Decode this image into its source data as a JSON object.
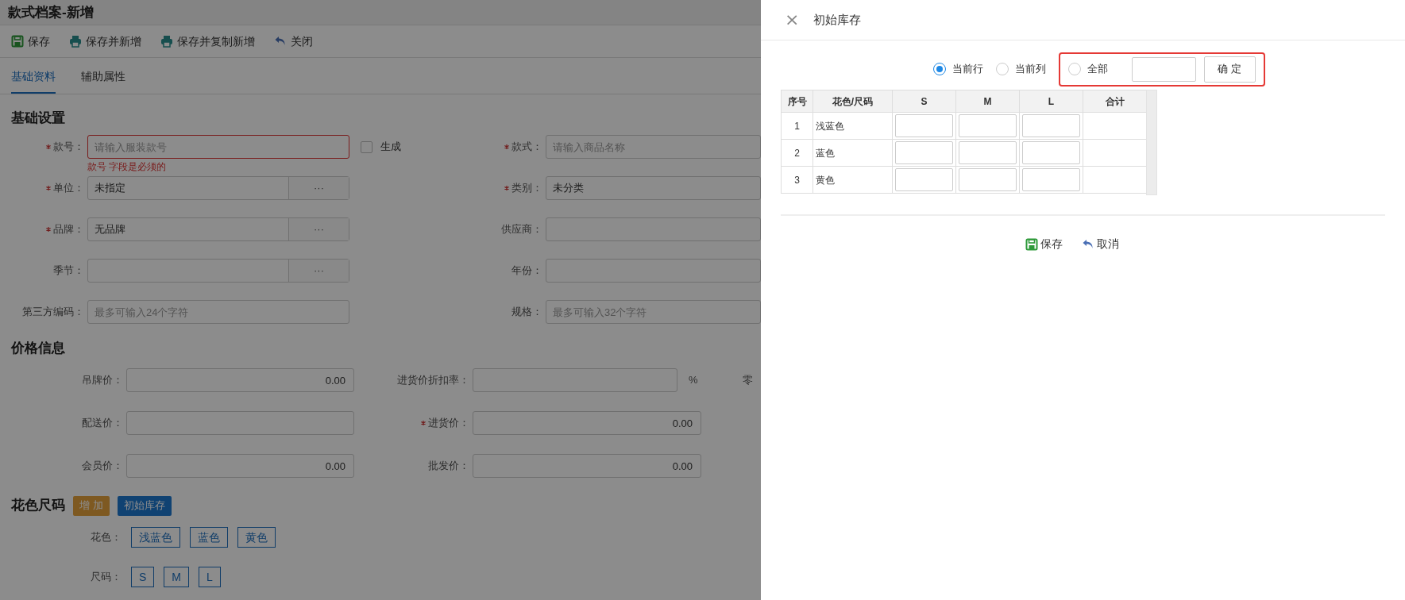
{
  "page": {
    "title": "款式档案-新增",
    "toolbar": [
      {
        "kind": "save",
        "label": "保存"
      },
      {
        "kind": "print",
        "label": "保存并新增"
      },
      {
        "kind": "print",
        "label": "保存并复制新增"
      },
      {
        "kind": "back",
        "label": "关闭"
      }
    ],
    "tabs": [
      {
        "label": "基础资料",
        "selected": true
      },
      {
        "label": "辅助属性",
        "selected": false
      }
    ],
    "basic_section": {
      "title": "基础设置",
      "fields": [
        {
          "label": "款号：",
          "required": true,
          "placeholder": "请输入服装款号",
          "error": "款号 字段是必须的",
          "checkbox": {
            "label": "生成",
            "checked": false
          }
        },
        {
          "label": "款式：",
          "required": true,
          "placeholder": "请输入商品名称"
        },
        {
          "label": "单位：",
          "required": true,
          "value": "未指定",
          "picker": "···"
        },
        {
          "label": "类别：",
          "required": true,
          "value": "未分类"
        },
        {
          "label": "品牌：",
          "required": true,
          "value": "无品牌",
          "picker": "···"
        },
        {
          "label": "供应商：",
          "required": false
        },
        {
          "label": "季节：",
          "required": false,
          "picker": "···"
        },
        {
          "label": "年份：",
          "required": false
        },
        {
          "label": "第三方编码：",
          "required": false,
          "placeholder": "最多可输入24个字符"
        },
        {
          "label": "规格：",
          "required": false,
          "placeholder": "最多可输入32个字符"
        }
      ]
    },
    "price_section": {
      "title": "价格信息",
      "rows": [
        [
          {
            "label": "吊牌价：",
            "required": false,
            "value": "0.00"
          },
          {
            "label": "进货价折扣率：",
            "required": false,
            "unit": "%"
          },
          {
            "label": "零",
            "required": false
          }
        ],
        [
          {
            "label": "配送价：",
            "required": false
          },
          {
            "label": "进货价：",
            "required": true,
            "value": "0.00"
          }
        ],
        [
          {
            "label": "会员价：",
            "required": false,
            "value": "0.00"
          },
          {
            "label": "批发价：",
            "required": false,
            "value": "0.00"
          }
        ]
      ]
    },
    "color_size_section": {
      "title": "花色尺码",
      "buttons": [
        {
          "kind": "warning",
          "label": "增 加"
        },
        {
          "kind": "primary",
          "label": "初始库存"
        }
      ],
      "groups": [
        {
          "label": "花色：",
          "tags": [
            "浅蓝色",
            "蓝色",
            "黄色"
          ]
        },
        {
          "label": "尺码：",
          "tags": [
            "S",
            "M",
            "L"
          ]
        }
      ]
    }
  },
  "drawer": {
    "title": "初始库存",
    "close": "×",
    "scope_options": [
      {
        "label": "当前行",
        "selected": true
      },
      {
        "label": "当前列",
        "selected": false
      },
      {
        "label": "全部",
        "selected": false
      }
    ],
    "confirm": "确 定",
    "table": {
      "columns": [
        "序号",
        "花色/尺码",
        "S",
        "M",
        "L",
        "合计"
      ],
      "rows": [
        {
          "index": "1",
          "name": "浅蓝色"
        },
        {
          "index": "2",
          "name": "蓝色"
        },
        {
          "index": "3",
          "name": "黄色"
        }
      ]
    },
    "footer": [
      {
        "kind": "save",
        "label": "保存"
      },
      {
        "kind": "back",
        "label": "取消"
      }
    ]
  }
}
